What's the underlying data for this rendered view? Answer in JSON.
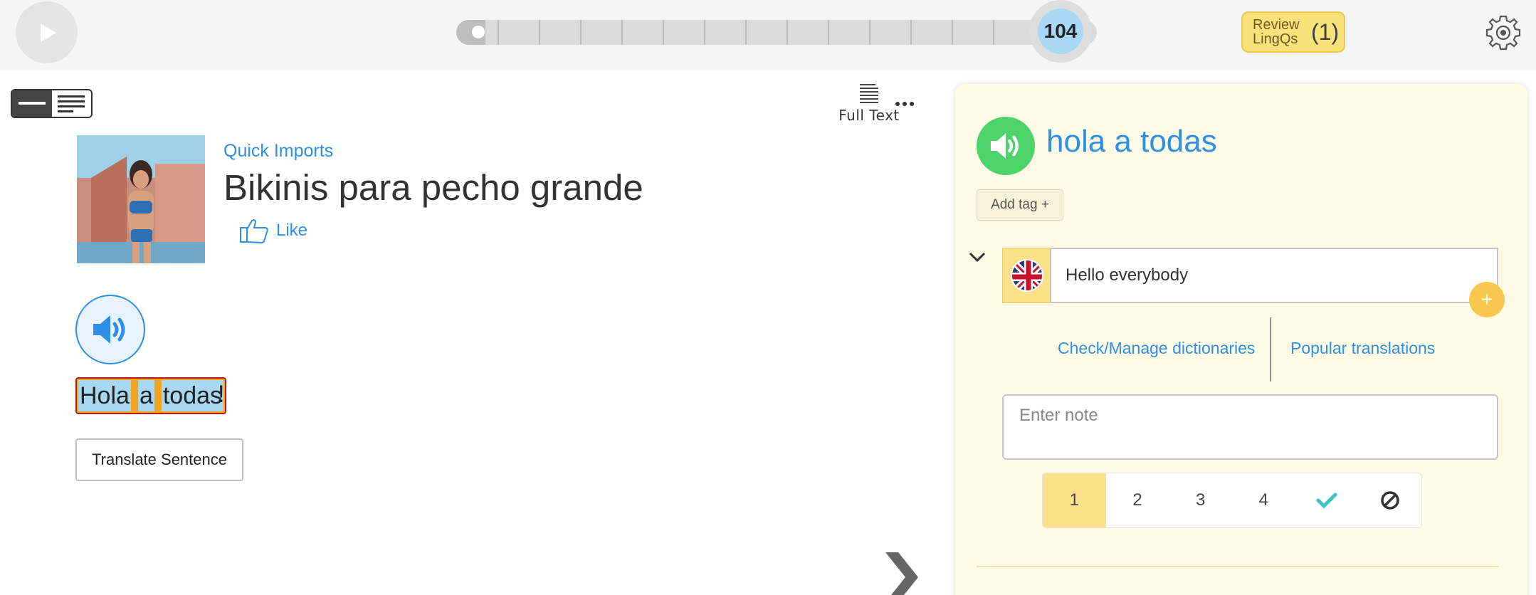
{
  "topbar": {
    "level": "104",
    "progress_percent": 4.5,
    "review": {
      "label": "Review LingQs",
      "count": "(1)"
    }
  },
  "reader": {
    "full_text_label": "Full Text",
    "course": "Quick Imports",
    "title": "Bikinis para pecho grande",
    "like_label": "Like",
    "sentence_words": [
      "Hola",
      "a",
      "todas"
    ],
    "sentence_punct": "!",
    "translate_label": "Translate Sentence"
  },
  "panel": {
    "term": "hola a todas",
    "add_tag": "Add tag +",
    "translation": "Hello everybody",
    "add_icon": "+",
    "dict_link": "Check/Manage dictionaries",
    "popular_link": "Popular translations",
    "note_placeholder": "Enter note",
    "statuses": [
      "1",
      "2",
      "3",
      "4"
    ],
    "active_status": "1"
  },
  "colors": {
    "accent_blue": "#2d8fe6",
    "highlight_orange": "#f4a31f",
    "highlight_blue": "#a8d7f0",
    "panel_bg": "#fffbe6",
    "green_audio": "#4cd46b",
    "check_teal": "#3fc2c2"
  },
  "icons": [
    "play-icon",
    "gear-icon",
    "speaker-icon",
    "thumbs-up-icon",
    "full-text-icon",
    "more-icon",
    "uk-flag-icon",
    "chevron-down-icon",
    "check-icon",
    "ignore-icon",
    "next-arrow-icon"
  ]
}
